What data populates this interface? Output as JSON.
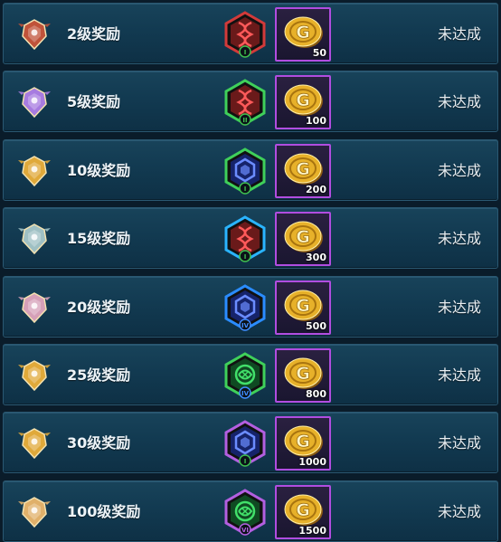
{
  "rewards": [
    {
      "level_label": "2级奖励",
      "coins": "50",
      "status": "未达成",
      "emblem_color": "#c0533a",
      "badge_border": "#d23a3a",
      "badge_fill": "#6a1a1a",
      "badge_icon_color": "#ff5a5a",
      "badge_tier": "I",
      "badge_tier_color": "#3fbf4f",
      "badge_icon": "dna-icon"
    },
    {
      "level_label": "5级奖励",
      "coins": "100",
      "status": "未达成",
      "emblem_color": "#a77be0",
      "badge_border": "#3fd05a",
      "badge_fill": "#6a1a1a",
      "badge_icon_color": "#ff5a5a",
      "badge_tier": "II",
      "badge_tier_color": "#3fbf4f",
      "badge_icon": "dna-icon"
    },
    {
      "level_label": "10级奖励",
      "coins": "200",
      "status": "未达成",
      "emblem_color": "#e0a93a",
      "badge_border": "#3fd05a",
      "badge_fill": "#16236a",
      "badge_icon_color": "#6b8cff",
      "badge_tier": "I",
      "badge_tier_color": "#3fbf4f",
      "badge_icon": "hex-core-icon"
    },
    {
      "level_label": "15级奖励",
      "coins": "300",
      "status": "未达成",
      "emblem_color": "#9fc0c4",
      "badge_border": "#2ab4ff",
      "badge_fill": "#6a1a1a",
      "badge_icon_color": "#ff5a5a",
      "badge_tier": "I",
      "badge_tier_color": "#3fbf4f",
      "badge_icon": "dna-icon"
    },
    {
      "level_label": "20级奖励",
      "coins": "500",
      "status": "未达成",
      "emblem_color": "#d6a0b8",
      "badge_border": "#2a8cff",
      "badge_fill": "#16236a",
      "badge_icon_color": "#6b8cff",
      "badge_tier": "IV",
      "badge_tier_color": "#3f8cff",
      "badge_icon": "hex-core-icon"
    },
    {
      "level_label": "25级奖励",
      "coins": "800",
      "status": "未达成",
      "emblem_color": "#e0a93a",
      "badge_border": "#3fd05a",
      "badge_fill": "#0f4a22",
      "badge_icon_color": "#42e06a",
      "badge_tier": "IV",
      "badge_tier_color": "#3f8cff",
      "badge_icon": "shield-swirl-icon"
    },
    {
      "level_label": "30级奖励",
      "coins": "1000",
      "status": "未达成",
      "emblem_color": "#e0a93a",
      "badge_border": "#b35fe0",
      "badge_fill": "#16236a",
      "badge_icon_color": "#6b8cff",
      "badge_tier": "I",
      "badge_tier_color": "#3fbf4f",
      "badge_icon": "hex-core-icon"
    },
    {
      "level_label": "100级奖励",
      "coins": "1500",
      "status": "未达成",
      "emblem_color": "#e0b06a",
      "badge_border": "#b35fe0",
      "badge_fill": "#0f4a22",
      "badge_icon_color": "#42e06a",
      "badge_tier": "VI",
      "badge_tier_color": "#b35fe0",
      "badge_icon": "shield-swirl-icon"
    }
  ],
  "coin": {
    "icon": "gold-coin-icon",
    "letter": "G",
    "color": "#e7b12a",
    "tile_border": "#b14de0"
  },
  "colors": {
    "background": "#0a1c2a",
    "row_border": "#2a5872",
    "row_fill": "#153e55",
    "text": "#eef4f8"
  }
}
